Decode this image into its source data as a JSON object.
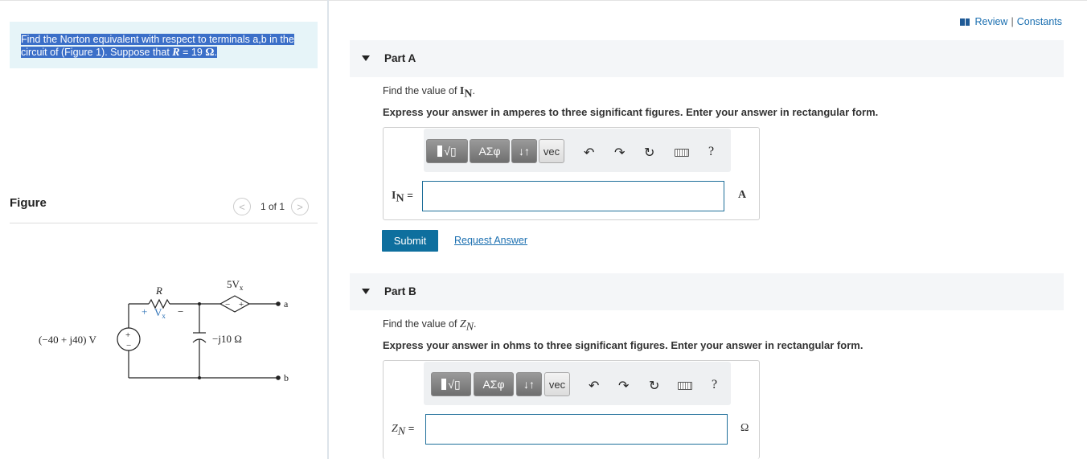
{
  "problem": {
    "line1": "Find the Norton equivalent with respect to terminals a,b in the",
    "line2_prefix": "circuit of (Figure 1). Suppose that ",
    "var": "R",
    "eq": " = 19 ",
    "unit": "Ω",
    "end": "."
  },
  "figure": {
    "title": "Figure",
    "pager": "1 of 1",
    "prev_icon": "<",
    "next_icon": ">",
    "labels": {
      "R": "R",
      "vx_plus": "+",
      "vx": "V",
      "vx_sub": "x",
      "vx_minus": "−",
      "dep_src": "5V",
      "dep_src_sub": "x",
      "dep_minus": "−",
      "dep_plus": "+",
      "src_value": "(−40 + j40) V",
      "src_plus": "+",
      "src_minus": "−",
      "cap": "−j10 Ω",
      "term_a": "a",
      "term_b": "b"
    }
  },
  "header": {
    "review": "Review",
    "sep": "|",
    "constants": "Constants"
  },
  "partA": {
    "label": "Part A",
    "q_prefix": "Find the value of ",
    "sym": "I",
    "sub": "N",
    "q_suffix": ".",
    "instruction": "Express your answer in amperes to three significant figures. Enter your answer in rectangular form.",
    "ans_eq": " =",
    "unit": "A"
  },
  "partB": {
    "label": "Part B",
    "q_prefix": "Find the value of ",
    "sym": "Z",
    "sub": "N",
    "q_suffix": ".",
    "instruction": "Express your answer in ohms to three significant figures. Enter your answer in rectangular form.",
    "ans_eq": " =",
    "unit": "Ω"
  },
  "toolbar": {
    "templates": "√▯",
    "greek": "ΑΣφ",
    "arrows": "↓↑",
    "vec": "vec",
    "undo": "↶",
    "redo": "↷",
    "reset": "↻",
    "help": "?"
  },
  "actions": {
    "submit": "Submit",
    "request": "Request Answer"
  }
}
